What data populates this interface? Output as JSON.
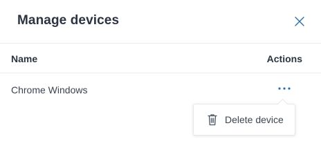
{
  "dialog": {
    "title": "Manage devices",
    "close_icon": "close-icon"
  },
  "table": {
    "columns": [
      "Name",
      "Actions"
    ],
    "rows": [
      {
        "name": "Chrome Windows",
        "actions_icon": "more-horizontal-icon"
      }
    ]
  },
  "context_menu": {
    "items": [
      {
        "icon": "trash-icon",
        "label": "Delete device"
      }
    ]
  },
  "colors": {
    "accent": "#2e6ea8",
    "text": "#2b3440",
    "divider": "#e6ecf2"
  }
}
